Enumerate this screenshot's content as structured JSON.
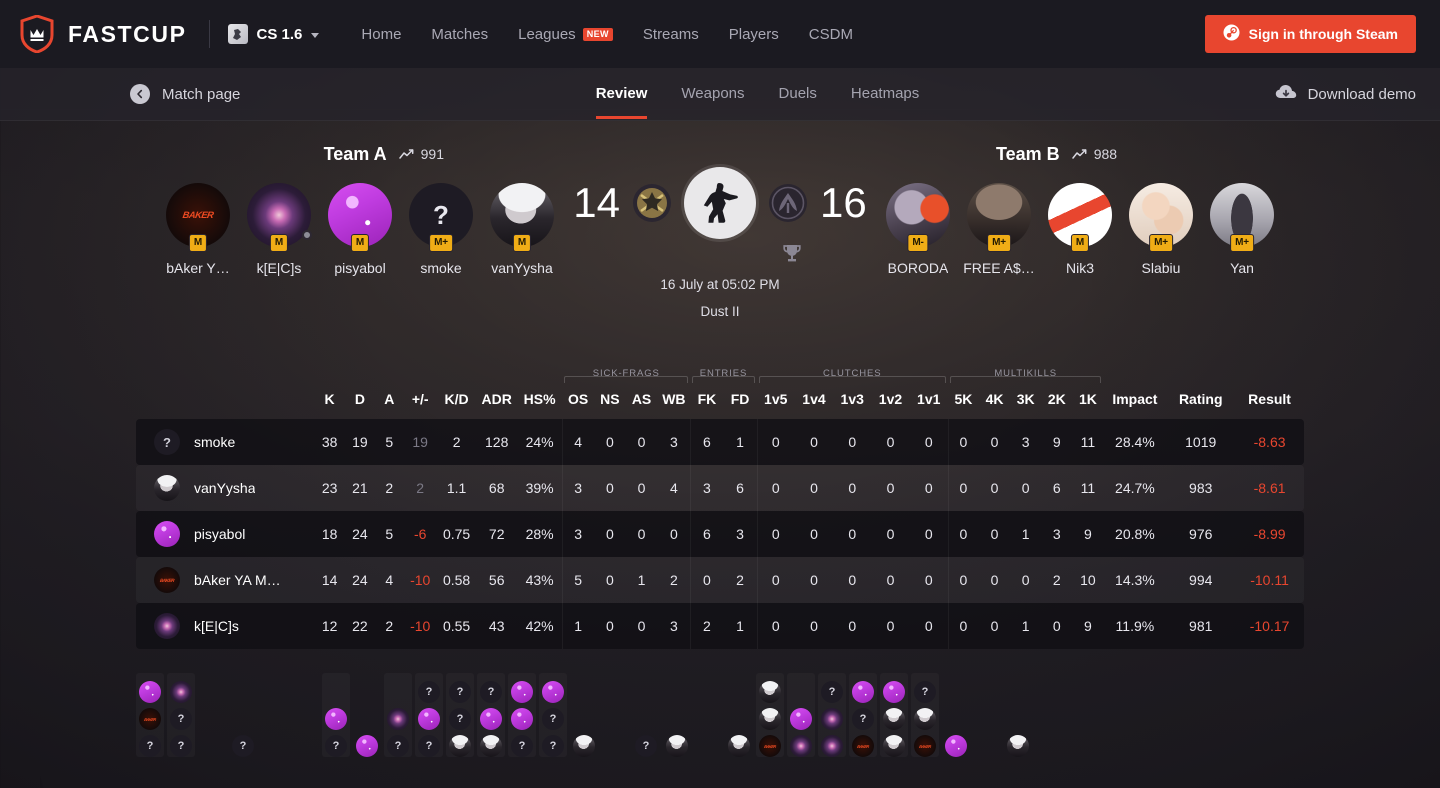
{
  "navbar": {
    "brand": "FASTCUP",
    "logo_icon": "shield-crown-icon",
    "game_selector": {
      "label": "CS 1.6",
      "icon": "cs-game-icon",
      "caret": "chevron-down-icon"
    },
    "links": [
      {
        "label": "Home",
        "badge": null
      },
      {
        "label": "Matches",
        "badge": null
      },
      {
        "label": "Leagues",
        "badge": "NEW"
      },
      {
        "label": "Streams",
        "badge": null
      },
      {
        "label": "Players",
        "badge": null
      },
      {
        "label": "CSDM",
        "badge": null
      }
    ],
    "signin": {
      "label": "Sign in through Steam",
      "icon": "steam-icon",
      "color": "#e8462f"
    }
  },
  "subnav": {
    "back": {
      "label": "Match page",
      "icon": "chevron-left-circle-icon"
    },
    "tabs": [
      {
        "label": "Review",
        "active": true
      },
      {
        "label": "Weapons",
        "active": false
      },
      {
        "label": "Duels",
        "active": false
      },
      {
        "label": "Heatmaps",
        "active": false
      }
    ],
    "download": {
      "label": "Download demo",
      "icon": "cloud-download-icon"
    }
  },
  "match": {
    "team_a": {
      "name": "Team A",
      "elo": "991",
      "score": "14"
    },
    "team_b": {
      "name": "Team B",
      "elo": "988",
      "score": "16"
    },
    "datetime": "16 July at 05:02 PM",
    "map": "Dust II",
    "center_icon": "counter-strike-icon",
    "left_team_logo": "star-crossed-weapons-icon",
    "right_team_logo": "trident-emblem-icon",
    "winner_icon": "trophy-icon",
    "winner_side": "right",
    "roster_a": [
      {
        "name": "bAker Y…",
        "badge": "M",
        "art": "av-baker",
        "initial": "",
        "online": false
      },
      {
        "name": "k[E|C]s",
        "badge": "M",
        "art": "av-kecs",
        "initial": "",
        "online": true
      },
      {
        "name": "pisyabol",
        "badge": "M",
        "art": "av-pisya",
        "initial": "",
        "online": false
      },
      {
        "name": "smoke",
        "badge": "M+",
        "art": "av-smoke",
        "initial": "?",
        "online": false
      },
      {
        "name": "vanYysha",
        "badge": "M",
        "art": "av-vanY",
        "initial": "",
        "online": false
      }
    ],
    "roster_b": [
      {
        "name": "BORODA",
        "badge": "M-",
        "art": "av-boroda",
        "initial": "",
        "online": false
      },
      {
        "name": "FREE A$…",
        "badge": "M+",
        "art": "av-free",
        "initial": "",
        "online": false
      },
      {
        "name": "Nik3",
        "badge": "M",
        "art": "av-nik3",
        "initial": "",
        "online": false
      },
      {
        "name": "Slabiu",
        "badge": "M+",
        "art": "av-slabiu",
        "initial": "",
        "online": false
      },
      {
        "name": "Yan",
        "badge": "M+",
        "art": "av-yan",
        "initial": "",
        "online": false
      }
    ]
  },
  "table": {
    "groups": [
      {
        "label": "SICK-FRAGS",
        "span": 4
      },
      {
        "label": "ENTRIES",
        "span": 2
      },
      {
        "label": "CLUTCHES",
        "span": 5
      },
      {
        "label": "MULTIKILLS",
        "span": 5
      }
    ],
    "columns": [
      "K",
      "D",
      "A",
      "+/-",
      "K/D",
      "ADR",
      "HS%",
      "OS",
      "NS",
      "AS",
      "WB",
      "FK",
      "FD",
      "1v5",
      "1v4",
      "1v3",
      "1v2",
      "1v1",
      "5K",
      "4K",
      "3K",
      "2K",
      "1K",
      "Impact",
      "Rating",
      "Result"
    ],
    "rows": [
      {
        "player": "smoke",
        "art": "av-smoke",
        "initial": "?",
        "k": "38",
        "d": "19",
        "a": "5",
        "pm": "19",
        "pm_sign": "dim",
        "kd": "2",
        "adr": "128",
        "hs": "24%",
        "os": "4",
        "ns": "0",
        "as": "0",
        "wb": "3",
        "fk": "6",
        "fd": "1",
        "c5": "0",
        "c4": "0",
        "c3": "0",
        "c2": "0",
        "c1": "0",
        "m5": "0",
        "m4": "0",
        "m3": "3",
        "m2": "9",
        "m1": "11",
        "impact": "28.4%",
        "rating": "1019",
        "result": "-8.63",
        "result_sign": "neg"
      },
      {
        "player": "vanYysha",
        "art": "av-vanY",
        "initial": "",
        "k": "23",
        "d": "21",
        "a": "2",
        "pm": "2",
        "pm_sign": "dim",
        "kd": "1.1",
        "adr": "68",
        "hs": "39%",
        "os": "3",
        "ns": "0",
        "as": "0",
        "wb": "4",
        "fk": "3",
        "fd": "6",
        "c5": "0",
        "c4": "0",
        "c3": "0",
        "c2": "0",
        "c1": "0",
        "m5": "0",
        "m4": "0",
        "m3": "0",
        "m2": "6",
        "m1": "11",
        "impact": "24.7%",
        "rating": "983",
        "result": "-8.61",
        "result_sign": "neg"
      },
      {
        "player": "pisyabol",
        "art": "av-pisya",
        "initial": "",
        "k": "18",
        "d": "24",
        "a": "5",
        "pm": "-6",
        "pm_sign": "neg",
        "kd": "0.75",
        "adr": "72",
        "hs": "28%",
        "os": "3",
        "ns": "0",
        "as": "0",
        "wb": "0",
        "fk": "6",
        "fd": "3",
        "c5": "0",
        "c4": "0",
        "c3": "0",
        "c2": "0",
        "c1": "0",
        "m5": "0",
        "m4": "0",
        "m3": "1",
        "m2": "3",
        "m1": "9",
        "impact": "20.8%",
        "rating": "976",
        "result": "-8.99",
        "result_sign": "neg"
      },
      {
        "player": "bAker YA M…",
        "art": "av-baker",
        "initial": "",
        "k": "14",
        "d": "24",
        "a": "4",
        "pm": "-10",
        "pm_sign": "neg",
        "kd": "0.58",
        "adr": "56",
        "hs": "43%",
        "os": "5",
        "ns": "0",
        "as": "1",
        "wb": "2",
        "fk": "0",
        "fd": "2",
        "c5": "0",
        "c4": "0",
        "c3": "0",
        "c2": "0",
        "c1": "0",
        "m5": "0",
        "m4": "0",
        "m3": "0",
        "m2": "2",
        "m1": "10",
        "impact": "14.3%",
        "rating": "994",
        "result": "-10.11",
        "result_sign": "neg"
      },
      {
        "player": "k[E|C]s",
        "art": "av-kecs",
        "initial": "",
        "k": "12",
        "d": "22",
        "a": "2",
        "pm": "-10",
        "pm_sign": "neg",
        "kd": "0.55",
        "adr": "43",
        "hs": "42%",
        "os": "1",
        "ns": "0",
        "as": "0",
        "wb": "3",
        "fk": "2",
        "fd": "1",
        "c5": "0",
        "c4": "0",
        "c3": "0",
        "c2": "0",
        "c1": "0",
        "m5": "0",
        "m4": "0",
        "m3": "1",
        "m2": "0",
        "m1": "9",
        "impact": "11.9%",
        "rating": "981",
        "result": "-10.17",
        "result_sign": "neg"
      }
    ]
  },
  "rounds": [
    {
      "shaded": true,
      "kills": [
        "av-pisya",
        "av-baker",
        "?"
      ]
    },
    {
      "shaded": true,
      "kills": [
        "av-kecs",
        "?",
        "?"
      ]
    },
    {
      "shaded": false,
      "kills": []
    },
    {
      "shaded": false,
      "kills": [
        "?"
      ]
    },
    {
      "shaded": false,
      "kills": []
    },
    {
      "shaded": false,
      "kills": []
    },
    {
      "shaded": true,
      "kills": [
        "av-pisya",
        "?"
      ]
    },
    {
      "shaded": false,
      "kills": [
        "av-pisya"
      ]
    },
    {
      "shaded": true,
      "kills": [
        "av-kecs",
        "?"
      ]
    },
    {
      "shaded": true,
      "kills": [
        "?",
        "av-pisya",
        "?"
      ]
    },
    {
      "shaded": true,
      "kills": [
        "?",
        "?",
        "av-vanY"
      ]
    },
    {
      "shaded": true,
      "kills": [
        "?",
        "av-pisya",
        "av-vanY"
      ]
    },
    {
      "shaded": true,
      "kills": [
        "av-pisya",
        "av-pisya",
        "?"
      ]
    },
    {
      "shaded": true,
      "kills": [
        "av-pisya",
        "?",
        "?"
      ]
    },
    {
      "shaded": false,
      "kills": [
        "av-vanY"
      ]
    },
    {
      "shaded": false,
      "kills": []
    },
    {
      "shaded": false,
      "kills": [
        "?"
      ]
    },
    {
      "shaded": false,
      "kills": [
        "av-vanY"
      ]
    },
    {
      "shaded": false,
      "kills": []
    },
    {
      "shaded": false,
      "kills": [
        "av-vanY"
      ]
    },
    {
      "shaded": true,
      "kills": [
        "av-vanY",
        "av-vanY",
        "av-baker"
      ]
    },
    {
      "shaded": true,
      "kills": [
        "av-pisya",
        "av-kecs"
      ]
    },
    {
      "shaded": true,
      "kills": [
        "?",
        "av-kecs",
        "av-kecs"
      ]
    },
    {
      "shaded": true,
      "kills": [
        "av-pisya",
        "?",
        "av-baker"
      ]
    },
    {
      "shaded": true,
      "kills": [
        "av-pisya",
        "av-vanY",
        "av-vanY"
      ]
    },
    {
      "shaded": true,
      "kills": [
        "?",
        "av-vanY",
        "av-baker"
      ]
    },
    {
      "shaded": false,
      "kills": [
        "av-pisya"
      ]
    },
    {
      "shaded": false,
      "kills": []
    },
    {
      "shaded": false,
      "kills": [
        "av-vanY"
      ]
    },
    {
      "shaded": false,
      "kills": []
    }
  ]
}
